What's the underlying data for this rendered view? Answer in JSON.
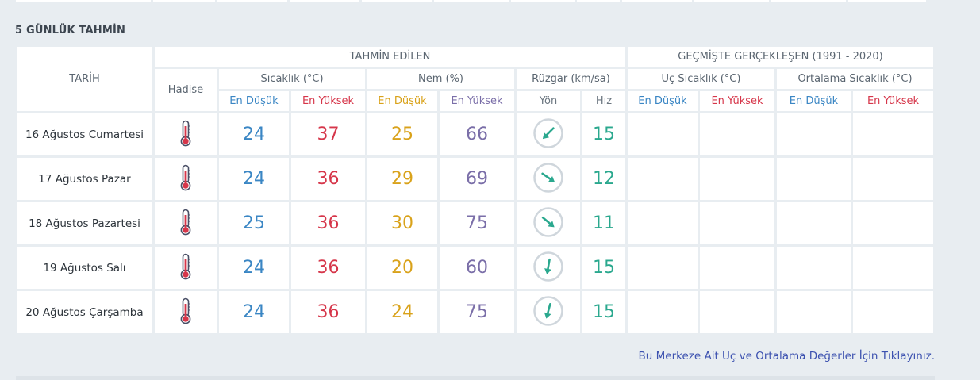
{
  "section": {
    "title": "5 GÜNLÜK TAHMİN"
  },
  "headers": {
    "tarih": "TARİH",
    "tahmin": "TAHMİN EDİLEN",
    "gecmis": "GEÇMİŞTE GERÇEKLEŞEN (1991 - 2020)",
    "hadise": "Hadise",
    "sicaklik": "Sıcaklık (°C)",
    "nem": "Nem (%)",
    "ruzgar": "Rüzgar (km/sa)",
    "uc_sicaklik": "Uç Sıcaklık (°C)",
    "ort_sicaklik": "Ortalama Sıcaklık (°C)",
    "en_dusuk": "En Düşük",
    "en_yuksek": "En Yüksek",
    "yon": "Yön",
    "hiz": "Hız"
  },
  "rows": [
    {
      "date": "16 Ağustos Cumartesi",
      "hadise_icon": "thermometer-icon",
      "temp_low": "24",
      "temp_high": "37",
      "hum_low": "25",
      "hum_high": "66",
      "wind_dir_deg": 225,
      "wind_speed": "15"
    },
    {
      "date": "17 Ağustos Pazar",
      "hadise_icon": "thermometer-icon",
      "temp_low": "24",
      "temp_high": "36",
      "hum_low": "29",
      "hum_high": "69",
      "wind_dir_deg": 125,
      "wind_speed": "12"
    },
    {
      "date": "18 Ağustos Pazartesi",
      "hadise_icon": "thermometer-icon",
      "temp_low": "25",
      "temp_high": "36",
      "hum_low": "30",
      "hum_high": "75",
      "wind_dir_deg": 130,
      "wind_speed": "11"
    },
    {
      "date": "19 Ağustos Salı",
      "hadise_icon": "thermometer-icon",
      "temp_low": "24",
      "temp_high": "36",
      "hum_low": "20",
      "hum_high": "60",
      "wind_dir_deg": 190,
      "wind_speed": "15"
    },
    {
      "date": "20 Ağustos Çarşamba",
      "hadise_icon": "thermometer-icon",
      "temp_low": "24",
      "temp_high": "36",
      "hum_low": "24",
      "hum_high": "75",
      "wind_dir_deg": 195,
      "wind_speed": "15"
    }
  ],
  "footer": {
    "link": "Bu Merkeze Ait Uç ve Ortalama Değerler İçin Tıklayınız."
  },
  "colors": {
    "low": "#3a86c4",
    "high": "#d6364a",
    "hum_low": "#d9a21a",
    "hum_high": "#7a6ea8",
    "wind": "#2aa88e",
    "link": "#3d52b0"
  }
}
